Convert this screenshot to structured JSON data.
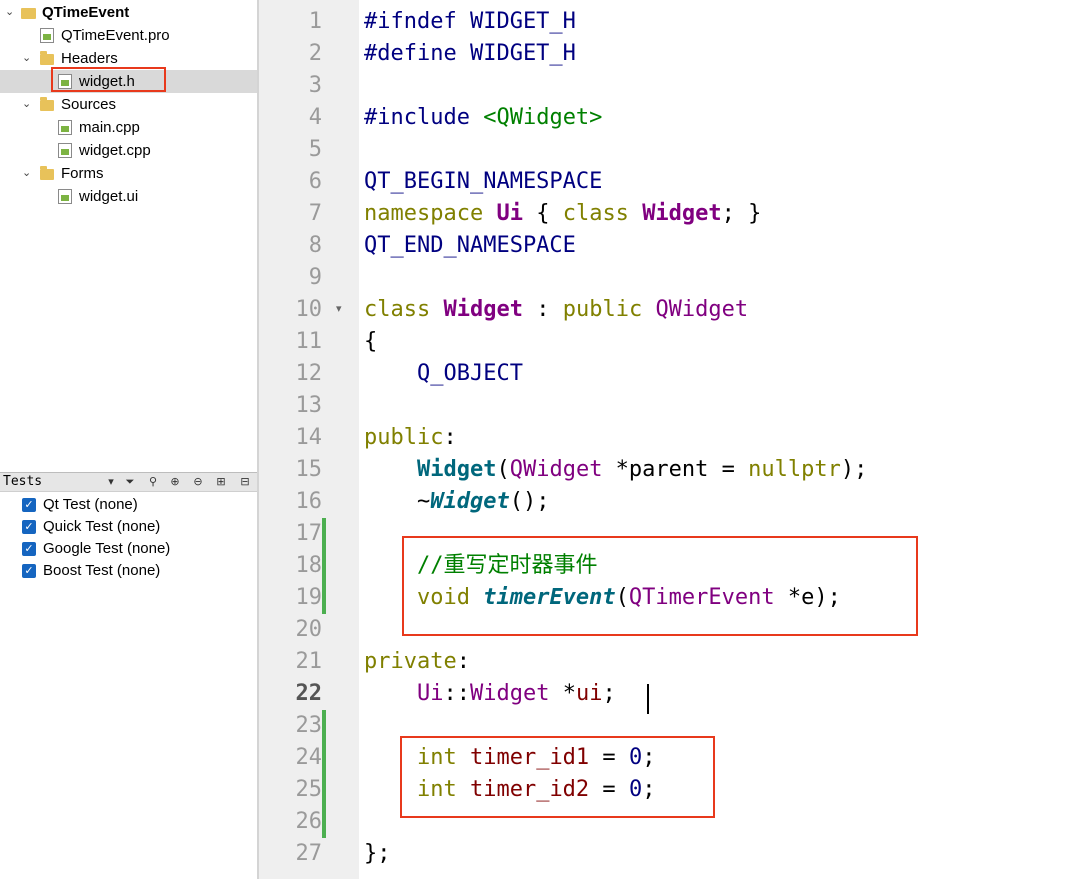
{
  "project_tree": {
    "project": "QTimeEvent",
    "pro_file": "QTimeEvent.pro",
    "headers": {
      "label": "Headers",
      "files": [
        "widget.h"
      ]
    },
    "sources": {
      "label": "Sources",
      "files": [
        "main.cpp",
        "widget.cpp"
      ]
    },
    "forms": {
      "label": "Forms",
      "files": [
        "widget.ui"
      ]
    },
    "selected_file": "widget.h"
  },
  "tests_panel": {
    "title": "Tests",
    "items": [
      {
        "label": "Qt Test (none)",
        "checked": true
      },
      {
        "label": "Quick Test (none)",
        "checked": true
      },
      {
        "label": "Google Test (none)",
        "checked": true
      },
      {
        "label": "Boost Test (none)",
        "checked": true
      }
    ]
  },
  "editor": {
    "current_line": "22",
    "line_numbers": [
      "1",
      "2",
      "3",
      "4",
      "5",
      "6",
      "7",
      "8",
      "9",
      "10",
      "11",
      "12",
      "13",
      "14",
      "15",
      "16",
      "17",
      "18",
      "19",
      "20",
      "21",
      "22",
      "23",
      "24",
      "25",
      "26",
      "27"
    ],
    "tokens": {
      "l1": "#ifndef WIDGET_H",
      "l2": "#define WIDGET_H",
      "l4a": "#include ",
      "l4b": "<QWidget>",
      "l6": "QT_BEGIN_NAMESPACE",
      "l7a": "namespace ",
      "l7b": "Ui",
      "l7c": " { ",
      "l7d": "class ",
      "l7e": "Widget",
      "l7f": "; }",
      "l8": "QT_END_NAMESPACE",
      "l10a": "class ",
      "l10b": "Widget",
      "l10c": " : ",
      "l10d": "public ",
      "l10e": "QWidget",
      "l11": "{",
      "l12": "    Q_OBJECT",
      "l14a": "public",
      "l14b": ":",
      "l15a": "    ",
      "l15b": "Widget",
      "l15c": "(",
      "l15d": "QWidget",
      "l15e": " *parent = ",
      "l15f": "nullptr",
      "l15g": ");",
      "l16a": "    ~",
      "l16b": "Widget",
      "l16c": "();",
      "l18": "    //重写定时器事件",
      "l19a": "    ",
      "l19b": "void ",
      "l19c": "timerEvent",
      "l19d": "(",
      "l19e": "QTimerEvent",
      "l19f": " *e);",
      "l21a": "private",
      "l21b": ":",
      "l22a": "    ",
      "l22b": "Ui",
      "l22c": "::",
      "l22d": "Widget",
      "l22e": " *",
      "l22f": "ui",
      "l22g": ";",
      "l24a": "    ",
      "l24b": "int ",
      "l24c": "timer_id1",
      "l24d": " = ",
      "l24e": "0",
      "l24f": ";",
      "l25a": "    ",
      "l25b": "int ",
      "l25c": "timer_id2",
      "l25d": " = ",
      "l25e": "0",
      "l25f": ";",
      "l27": "};"
    }
  },
  "colors": {
    "highlight_box": "#e8391c",
    "keyword": "#808000",
    "type": "#800080",
    "function": "#00677c",
    "comment_include": "#008000",
    "preprocessor_number": "#000080",
    "member_variable": "#800000",
    "change_marker": "#4caf50"
  }
}
